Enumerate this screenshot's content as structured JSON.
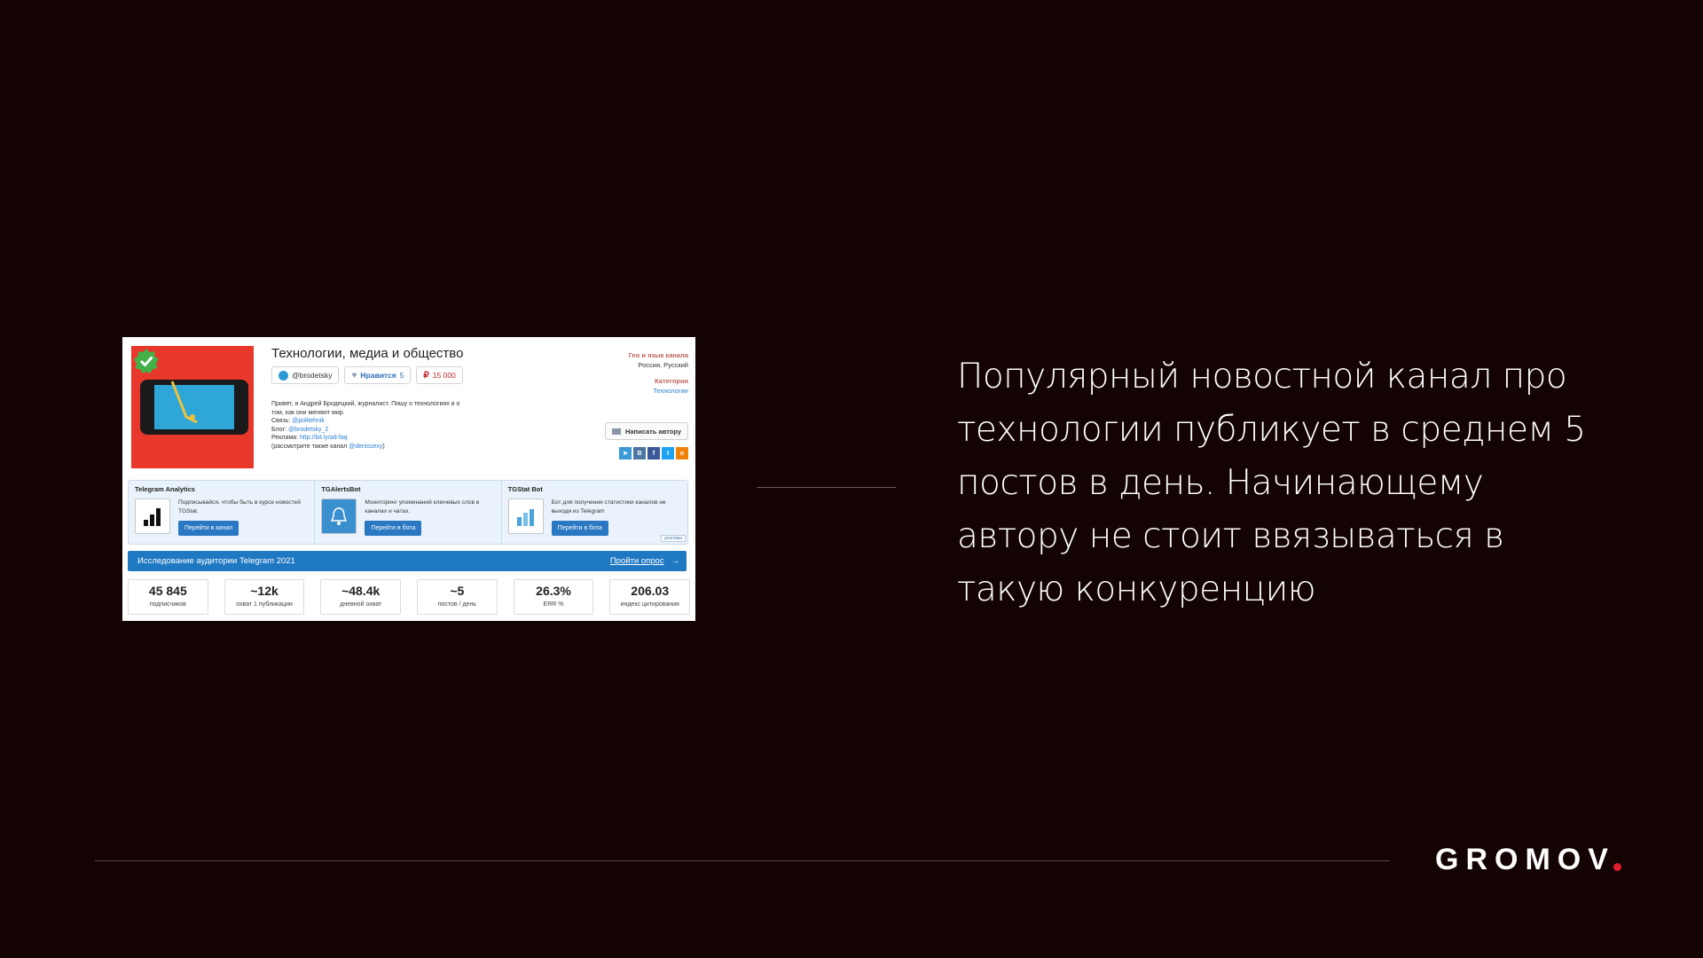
{
  "slide": {
    "main_text": "Популярный новостной канал про технологии публикует в среднем 5 постов в день. Начинающему автору не стоит ввязываться в такую конкуренцию",
    "logo": "GROMOV",
    "accent_color": "#e01e2d",
    "background_color": "#130303"
  },
  "channel": {
    "title": "Технологии, медиа и общество",
    "username": "@brodetsky",
    "likes_label": "Нравится",
    "likes_count": "5",
    "price": "15 000",
    "desc_line1": "Привет, я Андрей Бродецкий, журналист. Пишу о технологиях и о",
    "desc_line2": "том, как они меняют мир.",
    "contact_label": "Связь:",
    "contact_link": "@politehnik",
    "blog_label": "Блог:",
    "blog_link": "@brodetsky_2",
    "ads_label": "Реклама:",
    "ads_link": "http://bit.ly/ad-faq",
    "also_prefix": "(рассмотрите также канал",
    "also_link": "@denissexy",
    "also_suffix": ")",
    "geo_header": "Гео и язык канала",
    "geo_value": "Россия, Русский",
    "category_header": "Категория",
    "category_value": "Технологии",
    "write_button": "Написать автору",
    "share_icons": [
      "telegram-icon",
      "vk-icon",
      "facebook-icon",
      "twitter-icon",
      "odnoklassniki-icon"
    ]
  },
  "promos": [
    {
      "title": "Telegram Analytics",
      "text": "Подписывайся, чтобы быть в курсе новостей TGStat.",
      "button": "Перейти в канал",
      "icon": "bar-chart-icon"
    },
    {
      "title": "TGAlertsBot",
      "text": "Мониторинг упоминаний ключевых слов в каналах и чатах.",
      "button": "Перейти в бота",
      "icon": "bell-icon"
    },
    {
      "title": "TGStat Bot",
      "text": "Бот для получения статистики каналов не выходя из Telegram",
      "button": "Перейти в бота",
      "icon": "stats-bot-icon"
    }
  ],
  "promo_footer": "реклама",
  "survey": {
    "text": "Исследование аудитории Telegram 2021",
    "link": "Пройти опрос",
    "arrow": "→"
  },
  "stats": [
    {
      "value": "45 845",
      "label": "подписчиков"
    },
    {
      "value": "~12k",
      "label": "охват 1 публикации"
    },
    {
      "value": "~48.4k",
      "label": "дневной охват"
    },
    {
      "value": "~5",
      "label": "постов / день"
    },
    {
      "value": "26.3%",
      "label": "ERR %"
    },
    {
      "value": "206.03",
      "label": "индекс цитирования"
    }
  ]
}
